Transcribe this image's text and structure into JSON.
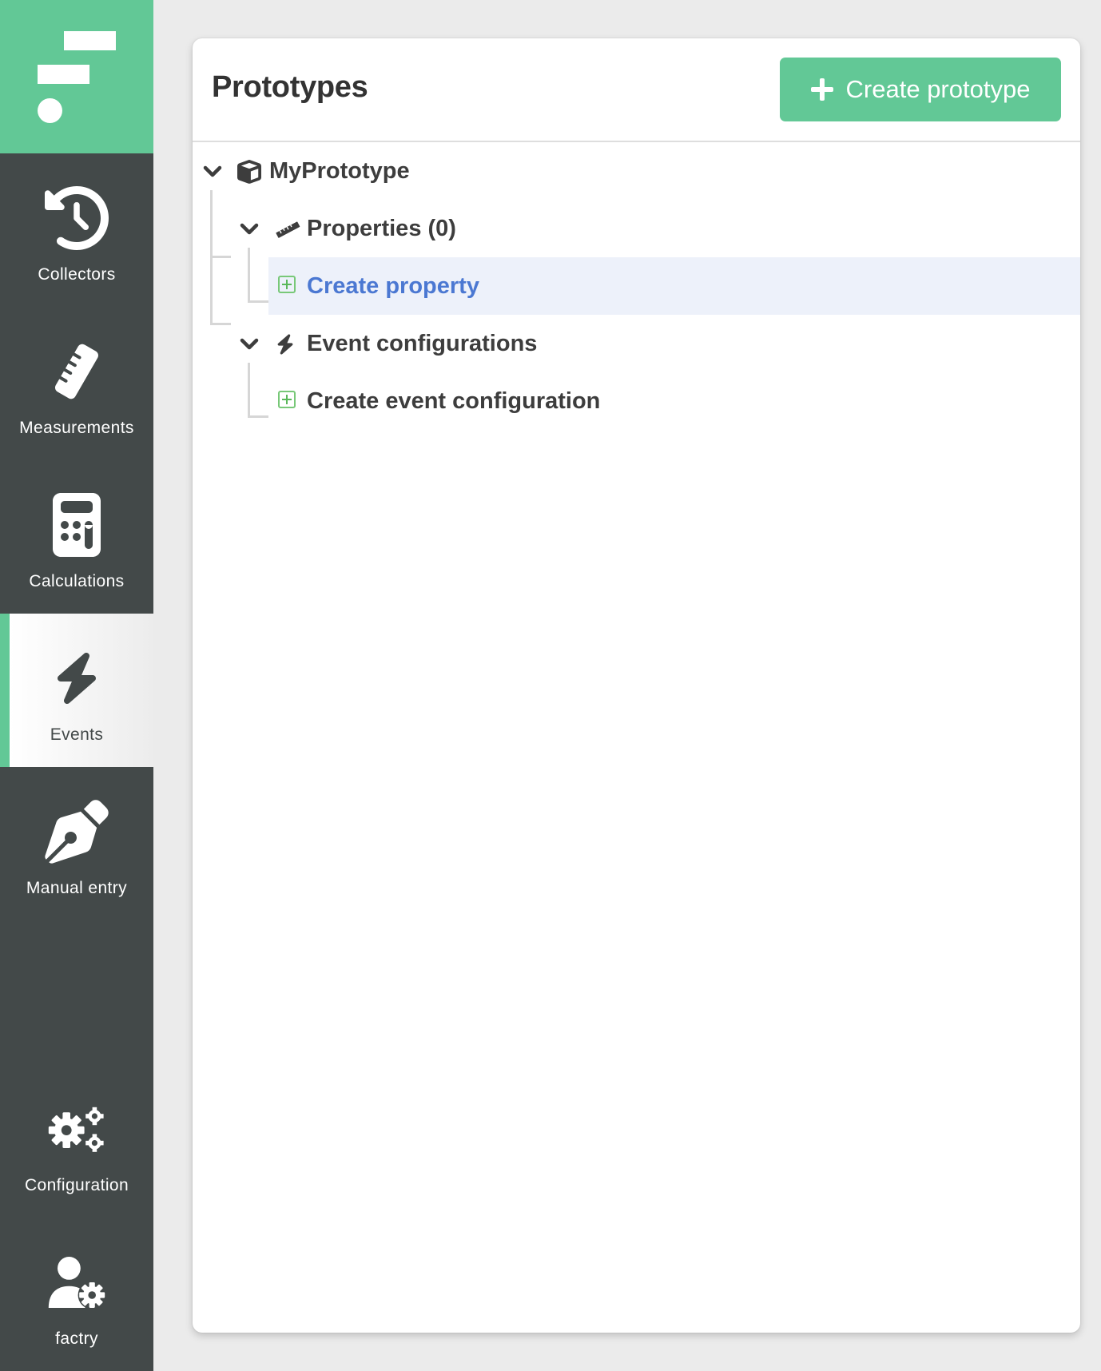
{
  "sidebar": {
    "logo": "factry-logo",
    "items": [
      {
        "label": "Collectors",
        "icon": "history-icon",
        "active": false
      },
      {
        "label": "Measurements",
        "icon": "ruler-icon",
        "active": false
      },
      {
        "label": "Calculations",
        "icon": "calculator-icon",
        "active": false
      },
      {
        "label": "Events",
        "icon": "bolt-icon",
        "active": true
      },
      {
        "label": "Manual entry",
        "icon": "pen-icon",
        "active": false
      }
    ],
    "bottom_items": [
      {
        "label": "Configuration",
        "icon": "gears-icon"
      },
      {
        "label": "factry",
        "icon": "user-gear-icon"
      }
    ]
  },
  "panel": {
    "title": "Prototypes",
    "create_button": "Create prototype",
    "tree": {
      "root": {
        "label": "MyPrototype",
        "icon": "cube-icon",
        "expanded": true
      },
      "properties": {
        "label": "Properties (0)",
        "icon": "ruler-icon",
        "expanded": true
      },
      "create_property": {
        "label": "Create property",
        "selected": true
      },
      "event_configurations": {
        "label": "Event configurations",
        "icon": "bolt-icon",
        "expanded": true
      },
      "create_event_configuration": {
        "label": "Create event configuration"
      }
    }
  },
  "colors": {
    "brand_green": "#62c896",
    "sidebar_bg": "#434949",
    "link_blue": "#4b78d2",
    "selected_row_bg": "#edf1fa"
  }
}
